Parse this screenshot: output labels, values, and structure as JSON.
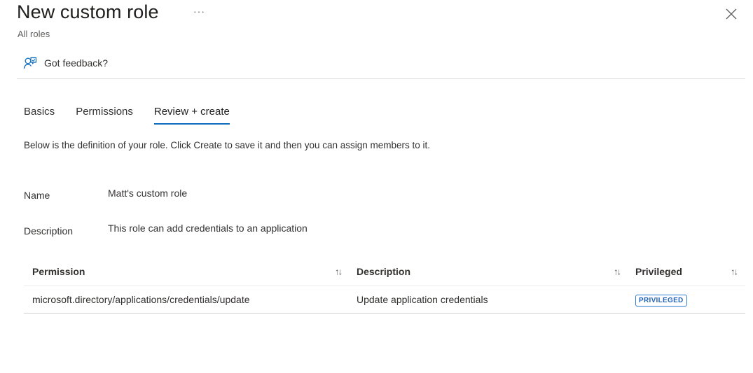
{
  "header": {
    "title": "New custom role",
    "more_label": "···",
    "breadcrumb": "All roles",
    "close_icon": "close-icon"
  },
  "toolbar": {
    "feedback_label": "Got feedback?",
    "feedback_icon": "feedback-person-icon"
  },
  "tabs": [
    {
      "label": "Basics",
      "active": false
    },
    {
      "label": "Permissions",
      "active": false
    },
    {
      "label": "Review + create",
      "active": true
    }
  ],
  "intro_text": "Below is the definition of your role. Click Create to save it and then you can assign members to it.",
  "fields": {
    "name_label": "Name",
    "name_value": "Matt's custom role",
    "description_label": "Description",
    "description_value": "This role can add credentials to an application"
  },
  "table": {
    "sort_glyph": "↑↓",
    "columns": [
      "Permission",
      "Description",
      "Privileged"
    ],
    "rows": [
      {
        "permission": "microsoft.directory/applications/credentials/update",
        "description": "Update application credentials",
        "privileged": "PRIVILEGED"
      }
    ]
  },
  "colors": {
    "accent": "#0f6cbd",
    "badge_border": "#2f7fd3",
    "badge_text": "#1f63b6"
  }
}
